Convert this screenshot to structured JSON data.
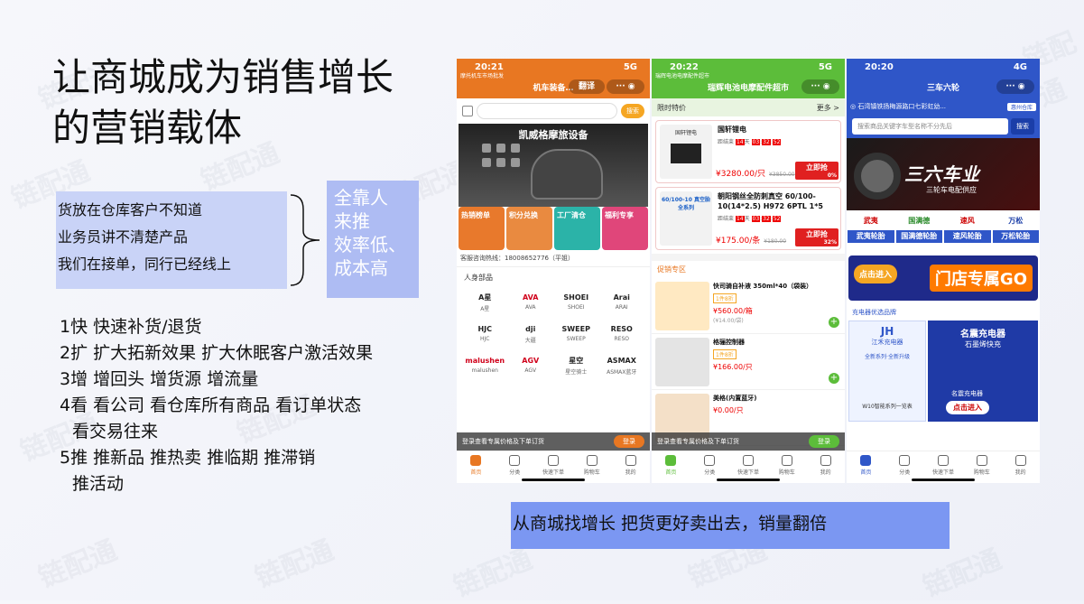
{
  "slide": {
    "title_line1": "让商城成为销售增长",
    "title_line2": "的营销载体",
    "pain_points": [
      "货放在仓库客户不知道",
      "业务员讲不清楚产品",
      "我们在接单，同行已经线上"
    ],
    "result_lines": [
      "全靠人",
      "来推",
      "效率低、",
      "成本高"
    ],
    "points": [
      "1快 快速补货/退货",
      "2扩 扩大拓新效果 扩大休眠客户激活效果",
      "3增 增回头 增货源  增流量",
      "4看 看公司  看仓库所有商品  看订单状态",
      "看交易往来",
      "5推 推新品  推热卖  推临期  推滞销",
      "推活动"
    ],
    "bottom_text": "从商城找增长  把货更好卖出去，销量翻倍",
    "watermark": "链配通"
  },
  "phone1": {
    "time": "20:21",
    "signal": "5G",
    "back_label": "摩托机车市场批发",
    "title": "机车装备…",
    "translate": "翻译",
    "search_button": "搜索",
    "banner_title": "凯威格摩旅设备",
    "categories": [
      "热销榜单",
      "积分兑换",
      "工厂清仓",
      "福利专享"
    ],
    "hotline": "客服咨询热线：18008652776（平姐）",
    "section": "人身部品",
    "brands": [
      {
        "logo": "A星",
        "name": "A星"
      },
      {
        "logo": "AVA",
        "name": "AVA"
      },
      {
        "logo": "SHOEI",
        "name": "SHOEI"
      },
      {
        "logo": "Arai",
        "name": "ARAI"
      },
      {
        "logo": "HJC",
        "name": "HJC"
      },
      {
        "logo": "dji",
        "name": "大疆"
      },
      {
        "logo": "SWEEP",
        "name": "SWEEP"
      },
      {
        "logo": "RESO",
        "name": "RESO"
      },
      {
        "logo": "malushen",
        "name": "malushen"
      },
      {
        "logo": "AGV",
        "name": "AGV"
      },
      {
        "logo": "星空",
        "name": "星空骑士"
      },
      {
        "logo": "ASMAX",
        "name": "ASMAX蓝牙"
      }
    ],
    "login_text": "登录查看专属价格及下单订货",
    "login_button": "登录",
    "tabs": [
      "首页",
      "分类",
      "快速下单",
      "购物车",
      "我的"
    ]
  },
  "phone2": {
    "time": "20:22",
    "signal": "5G",
    "back_label": "瑞辉电池电摩配件超市",
    "title": "瑞辉电池电摩配件超市",
    "flash_label": "限时特价",
    "more": "更多 >",
    "flash_items": [
      {
        "pic": "国轩锂电",
        "name": "国轩锂电",
        "countdown_prefix": "距结束",
        "days": "14",
        "h": "03",
        "m": "32",
        "s": "52",
        "price": "¥3280.00/只",
        "orig": "¥3850.00",
        "grab": "立即抢",
        "pct": "0%"
      },
      {
        "pic": "60/100-10 真空胎 全系列",
        "name": "朝阳钢丝全防刺真空 60/100-10(14*2.5) H972 6PTL 1*5",
        "countdown_prefix": "距结束",
        "days": "14",
        "h": "03",
        "m": "32",
        "s": "52",
        "price": "¥175.00/条",
        "orig": "¥180.00",
        "grab": "立即抢",
        "pct": "32%"
      }
    ],
    "promo_label": "促销专区",
    "promos": [
      {
        "name": "快司骑自补液 350ml*40（袋装）",
        "tag": "1件8折",
        "price": "¥560.00/箱",
        "sub": "(¥14.00/袋)"
      },
      {
        "name": "格骊控制器",
        "tag": "1件8折",
        "price": "¥166.00/只",
        "sub": ""
      },
      {
        "name": "美格(内置蓝牙)",
        "tag": "",
        "price": "¥0.00/只",
        "sub": ""
      }
    ],
    "login_text": "登录查看专属价格及下单订货",
    "login_button": "登录",
    "tabs": [
      "首页",
      "分类",
      "快速下单",
      "购物车",
      "我的"
    ]
  },
  "phone3": {
    "time": "20:20",
    "signal": "4G",
    "title": "三车六轮",
    "address": "石湾镇铁扬梅源路口七彩虹幼...",
    "warehouse": "惠州仓库",
    "search_placeholder": "搜索商品关键字车型名称不分先后",
    "search_button": "搜索",
    "banner_big": "三六车业",
    "banner_small": "三轮车电配供应",
    "tires": [
      {
        "logo": "武夷",
        "name": "武夷轮胎"
      },
      {
        "logo": "国满德",
        "name": "国满德轮胎"
      },
      {
        "logo": "速风",
        "name": "速风轮胎"
      },
      {
        "logo": "万松",
        "name": "万松轮胎"
      }
    ],
    "store_left": "点击进入",
    "store_right": "门店专属GO",
    "charger_head": "充电器优选品牌",
    "charger_brand": "JH",
    "charger_brand_name": "江禾充电器",
    "charger_tag": "全新系列·全新升级",
    "charger_model": "W10智能系列一览表",
    "charger_right_title": "名震充电器",
    "charger_right_sub": "石墨烯快充",
    "charger_right_btn": "点击进入",
    "charger_right_foot": "名震充电器",
    "tabs": [
      "首页",
      "分类",
      "快速下单",
      "购物车",
      "我的"
    ]
  }
}
